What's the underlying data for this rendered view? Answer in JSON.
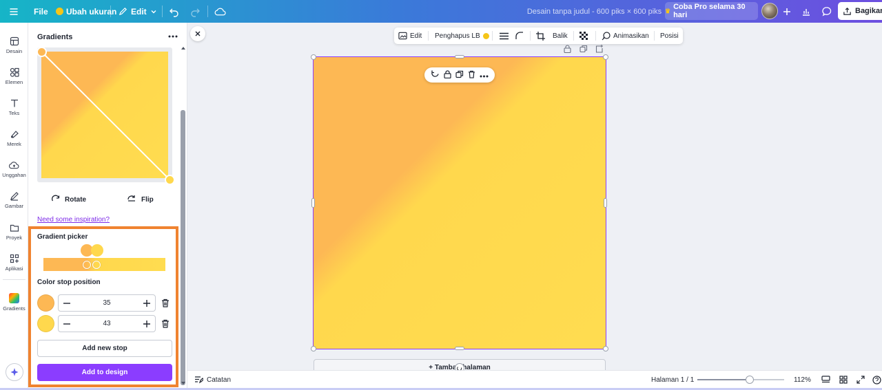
{
  "topbar": {
    "file_label": "File",
    "resize_label": "Ubah ukuran",
    "edit_label": "Edit",
    "doc_title": "Desain tanpa judul - 600 piks × 600 piks",
    "pro_label": "Coba Pro selama 30 hari",
    "share_label": "Bagikan"
  },
  "rail": {
    "items": [
      {
        "label": "Desain",
        "icon": "layout-icon"
      },
      {
        "label": "Elemen",
        "icon": "shapes-icon"
      },
      {
        "label": "Teks",
        "icon": "text-icon"
      },
      {
        "label": "Merek",
        "icon": "brand-icon"
      },
      {
        "label": "Unggahan",
        "icon": "cloud-upload-icon"
      },
      {
        "label": "Gambar",
        "icon": "pencil-icon"
      },
      {
        "label": "Proyek",
        "icon": "folder-icon"
      },
      {
        "label": "Aplikasi",
        "icon": "apps-icon"
      },
      {
        "label": "Gradients",
        "icon": "gradients-app-icon"
      }
    ]
  },
  "panel": {
    "title": "Gradients",
    "rotate_label": "Rotate",
    "flip_label": "Flip",
    "inspiration_link": "Need some inspiration?",
    "gradient_picker_title": "Gradient picker",
    "color_stop_title": "Color stop position",
    "stops": [
      {
        "color": "#fdb854",
        "value": "35"
      },
      {
        "color": "#ffd84d",
        "value": "43"
      }
    ],
    "add_stop_label": "Add new stop",
    "add_design_label": "Add to design"
  },
  "context_toolbar": {
    "edit_label": "Edit",
    "bg_remover_label": "Penghapus LB",
    "flip_label": "Balik",
    "animate_label": "Animasikan",
    "position_label": "Posisi"
  },
  "canvas": {
    "add_page_label": "+ Tambah halaman",
    "gradient_start": "#fdb854",
    "gradient_end": "#ffdc50",
    "selection_color": "#8b3dff"
  },
  "bottombar": {
    "notes_label": "Catatan",
    "page_label": "Halaman 1 / 1",
    "zoom_label": "112%",
    "zoom_level": 0.6
  },
  "colors": {
    "accent_purple": "#8b3dff",
    "highlight_orange": "#f08330",
    "link_purple": "#7d2ae8"
  }
}
